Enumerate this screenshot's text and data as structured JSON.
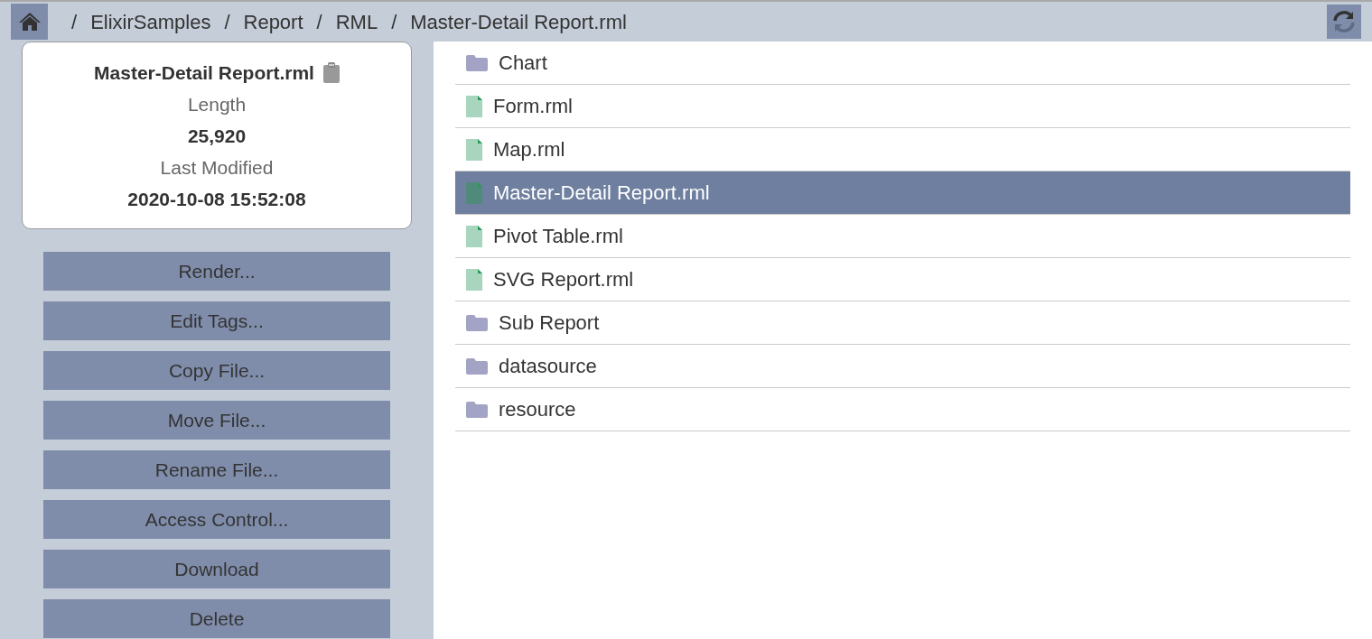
{
  "breadcrumb": [
    "/",
    "ElixirSamples",
    "/",
    "Report",
    "/",
    "RML",
    "/",
    "Master-Detail Report.rml"
  ],
  "details": {
    "name": "Master-Detail Report.rml",
    "fields": [
      {
        "label": "Length",
        "value": "25,920"
      },
      {
        "label": "Last Modified",
        "value": "2020-10-08 15:52:08"
      }
    ]
  },
  "actions": [
    "Render...",
    "Edit Tags...",
    "Copy File...",
    "Move File...",
    "Rename File...",
    "Access Control...",
    "Download",
    "Delete"
  ],
  "entries": [
    {
      "name": "Chart",
      "kind": "folder",
      "selected": false
    },
    {
      "name": "Form.rml",
      "kind": "file",
      "selected": false
    },
    {
      "name": "Map.rml",
      "kind": "file",
      "selected": false
    },
    {
      "name": "Master-Detail Report.rml",
      "kind": "file",
      "selected": true
    },
    {
      "name": "Pivot Table.rml",
      "kind": "file",
      "selected": false
    },
    {
      "name": "SVG Report.rml",
      "kind": "file",
      "selected": false
    },
    {
      "name": "Sub Report",
      "kind": "folder",
      "selected": false
    },
    {
      "name": "datasource",
      "kind": "folder",
      "selected": false
    },
    {
      "name": "resource",
      "kind": "folder",
      "selected": false
    }
  ]
}
